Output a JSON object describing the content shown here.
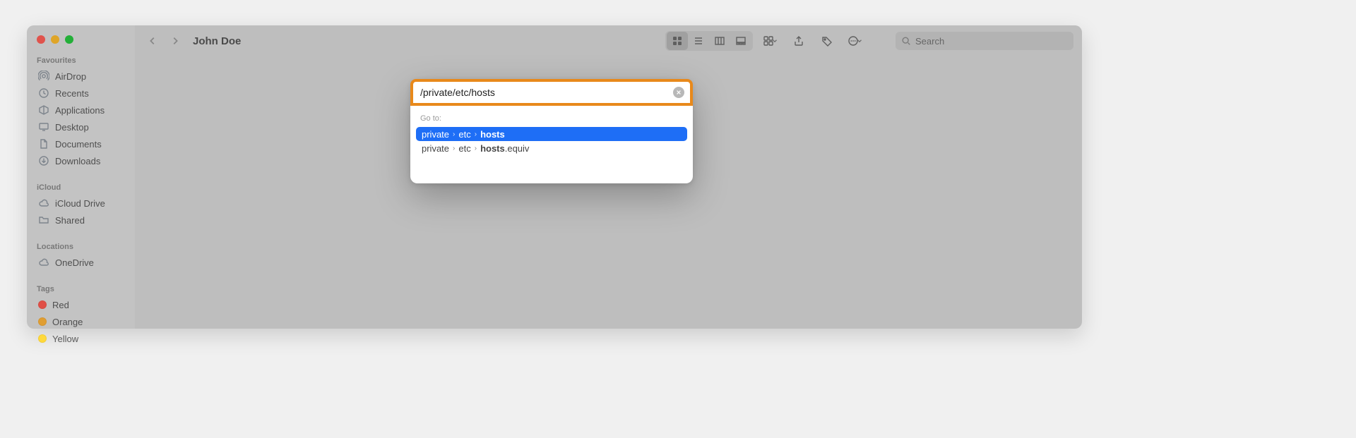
{
  "window": {
    "title": "John Doe"
  },
  "sidebar": {
    "sections": [
      {
        "title": "Favourites",
        "items": [
          {
            "icon": "airdrop-icon",
            "label": "AirDrop"
          },
          {
            "icon": "clock-icon",
            "label": "Recents"
          },
          {
            "icon": "applications-icon",
            "label": "Applications"
          },
          {
            "icon": "desktop-icon",
            "label": "Desktop"
          },
          {
            "icon": "document-icon",
            "label": "Documents"
          },
          {
            "icon": "download-icon",
            "label": "Downloads"
          }
        ]
      },
      {
        "title": "iCloud",
        "items": [
          {
            "icon": "cloud-icon",
            "label": "iCloud Drive"
          },
          {
            "icon": "folder-icon",
            "label": "Shared"
          }
        ]
      },
      {
        "title": "Locations",
        "items": [
          {
            "icon": "cloud-outline-icon",
            "label": "OneDrive"
          }
        ]
      },
      {
        "title": "Tags",
        "items": [
          {
            "color": "#ff5b51",
            "label": "Red"
          },
          {
            "color": "#ffb43a",
            "label": "Orange"
          },
          {
            "color": "#ffd93b",
            "label": "Yellow"
          }
        ]
      }
    ]
  },
  "toolbar": {
    "search_placeholder": "Search"
  },
  "goto": {
    "input_value": "/private/etc/hosts",
    "section_label": "Go to:",
    "results": [
      {
        "segments": [
          "private",
          "etc"
        ],
        "match": "hosts",
        "suffix": "",
        "selected": true
      },
      {
        "segments": [
          "private",
          "etc"
        ],
        "match": "hosts",
        "suffix": ".equiv",
        "selected": false
      }
    ]
  }
}
